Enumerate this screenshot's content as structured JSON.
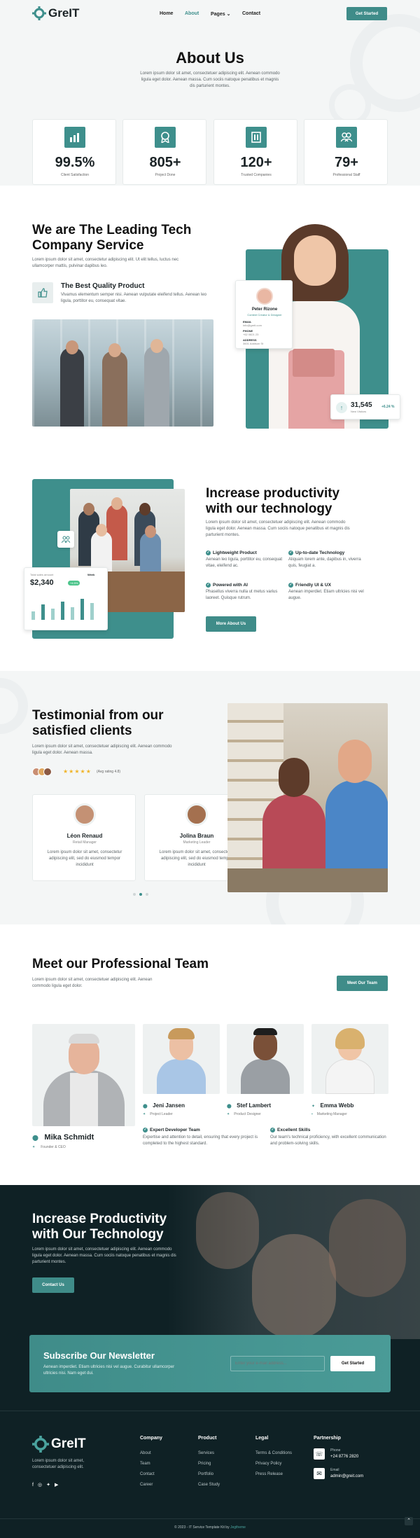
{
  "brand": {
    "name": "GreIT"
  },
  "nav": {
    "home": "Home",
    "about": "About",
    "pages": "Pages",
    "contact": "Contact",
    "cta": "Get Started"
  },
  "hero": {
    "title": "About Us",
    "desc": "Lorem ipsum dolor sit amet, consectetuer adipiscing elit. Aenean commodo ligula eget dolor. Aenean massa. Cum sociis natoque penatibus et magnis dis parturient montes."
  },
  "stats": [
    {
      "value": "99.5%",
      "label": "Client Satisfaction",
      "icon": "chart-icon"
    },
    {
      "value": "805+",
      "label": "Project Done",
      "icon": "award-icon"
    },
    {
      "value": "120+",
      "label": "Trusted Companies",
      "icon": "building-icon"
    },
    {
      "value": "79+",
      "label": "Professional Staff",
      "icon": "team-icon"
    }
  ],
  "leading": {
    "title": "We are The Leading Tech Company Service",
    "desc": "Lorem ipsum dolor sit amet, consectetur adipiscing elit. Ut elit tellus, luctus nec ullamcorper mattis, pulvinar dapibus leo.",
    "feature_title": "The Best Quality Product",
    "feature_desc": "Vivamus elementum semper nisi. Aenean vulputate eleifend tellus. Aenean leo ligula, porttitor eu, consequat vitae.",
    "profile": {
      "name": "Peter Rizone",
      "role": "Content Creator & Designer",
      "f1": "EMAIL",
      "f1v": "info@greit.com",
      "f2": "PHONE",
      "f2v": "+62 0821 23",
      "f3": "ADDRESS",
      "f3v": "3601 Addison St"
    },
    "badge": {
      "value": "31,545",
      "label": "New Visitors",
      "delta": "+6.24 %"
    }
  },
  "productivity": {
    "title": "Increase productivity with our technology",
    "desc": "Lorem ipsum dolor sit amet, consectetuer adipiscing elit. Aenean commodo ligula eget dolor. Aenean massa. Cum sociis natoque penatibus et magnis dis parturient montes.",
    "features": [
      {
        "title": "Lightweight Product",
        "desc": "Aenean leo ligula, porttitor eu, consequat vitae, eleifend ac."
      },
      {
        "title": "Up-to-date Technology",
        "desc": "Aliquam lorem ante, dapibus in, viverra quis, feugiat a."
      },
      {
        "title": "Powered with AI",
        "desc": "Phasellus viverra nulla ut metus varius laoreet. Quisque rutrum."
      },
      {
        "title": "Friendly UI & UX",
        "desc": "Aenean imperdiet. Etiam ultricies nisi vel augue."
      }
    ],
    "cta": "More About Us",
    "widget": {
      "label": "Total sales amount",
      "period": "Week",
      "value": "$2,340",
      "tag": "+4.5%"
    }
  },
  "testimonial": {
    "title": "Testimonial from our satisfied clients",
    "desc": "Lorem ipsum dolor sit amet, consectetuer adipiscing elit. Aenean commodo ligula eget dolor. Aenean massa.",
    "stars": "★★★★★",
    "rating": "(Avg rating 4.8)",
    "items": [
      {
        "name": "Léon Renaud",
        "role": "Retail Manager",
        "quote": "Lorem ipsum dolor sit amet, consectetur adipiscing elit, sed do eiusmod tempor incididunt"
      },
      {
        "name": "Jolina Braun",
        "role": "Marketing Leader",
        "quote": "Lorem ipsum dolor sit amet, consectetur adipiscing elit, sed do eiusmod tempor incididunt"
      }
    ]
  },
  "team": {
    "title": "Meet our Professional Team",
    "desc": "Lorem ipsum dolor sit amet, consectetuer adipiscing elit. Aenean commodo ligula eget dolor.",
    "cta": "Meet Our Team",
    "members": [
      {
        "name": "Mika Schmidt",
        "role": "Founder & CEO"
      },
      {
        "name": "Jeni Jansen",
        "role": "Project Leader"
      },
      {
        "name": "Stef Lambert",
        "role": "Product Designer"
      },
      {
        "name": "Emma Webb",
        "role": "Marketing Manager"
      }
    ],
    "skills": [
      {
        "title": "Expert Developer Team",
        "desc": "Expertise and attention to detail, ensuring that every project is completed to the highest standard."
      },
      {
        "title": "Excellent Skills",
        "desc": "Our team's technical proficiency, with excellent communication and problem-solving skills."
      }
    ]
  },
  "banner": {
    "title": "Increase Productivity with Our Technology",
    "desc": "Lorem ipsum dolor sit amet, consectetuer adipiscing elit. Aenean commodo ligula eget dolor. Aenean massa. Cum sociis natoque penatibus et magnis dis parturient montes.",
    "cta": "Contact Us"
  },
  "newsletter": {
    "title": "Subscribe Our Newsletter",
    "desc": "Aenean imperdiet. Etiam ultricies nisi vel augue. Curabitur ullamcorper ultricies nisi. Nam eget dui.",
    "placeholder": "Enter your e-mail address...",
    "cta": "Get Started"
  },
  "footer": {
    "desc": "Lorem ipsum dolor sit amet, consectetuer adipiscing elit.",
    "company": {
      "title": "Company",
      "links": [
        "About",
        "Team",
        "Contact",
        "Career"
      ]
    },
    "product": {
      "title": "Product",
      "links": [
        "Services",
        "Pricing",
        "Portfolio",
        "Case Study"
      ]
    },
    "legal": {
      "title": "Legal",
      "links": [
        "Terms & Conditions",
        "Privacy Policy",
        "Press Release"
      ]
    },
    "partnership": {
      "title": "Partnership",
      "phone_label": "Phone",
      "phone": "+24 8776 2820",
      "email_label": "Email",
      "email": "admin@greit.com"
    },
    "copyright": "© 2023 - IT Service Template Kit by ",
    "credit": "Jegtheme"
  },
  "colors": {
    "accent": "#3e8f8c",
    "dark": "#0f2125"
  }
}
